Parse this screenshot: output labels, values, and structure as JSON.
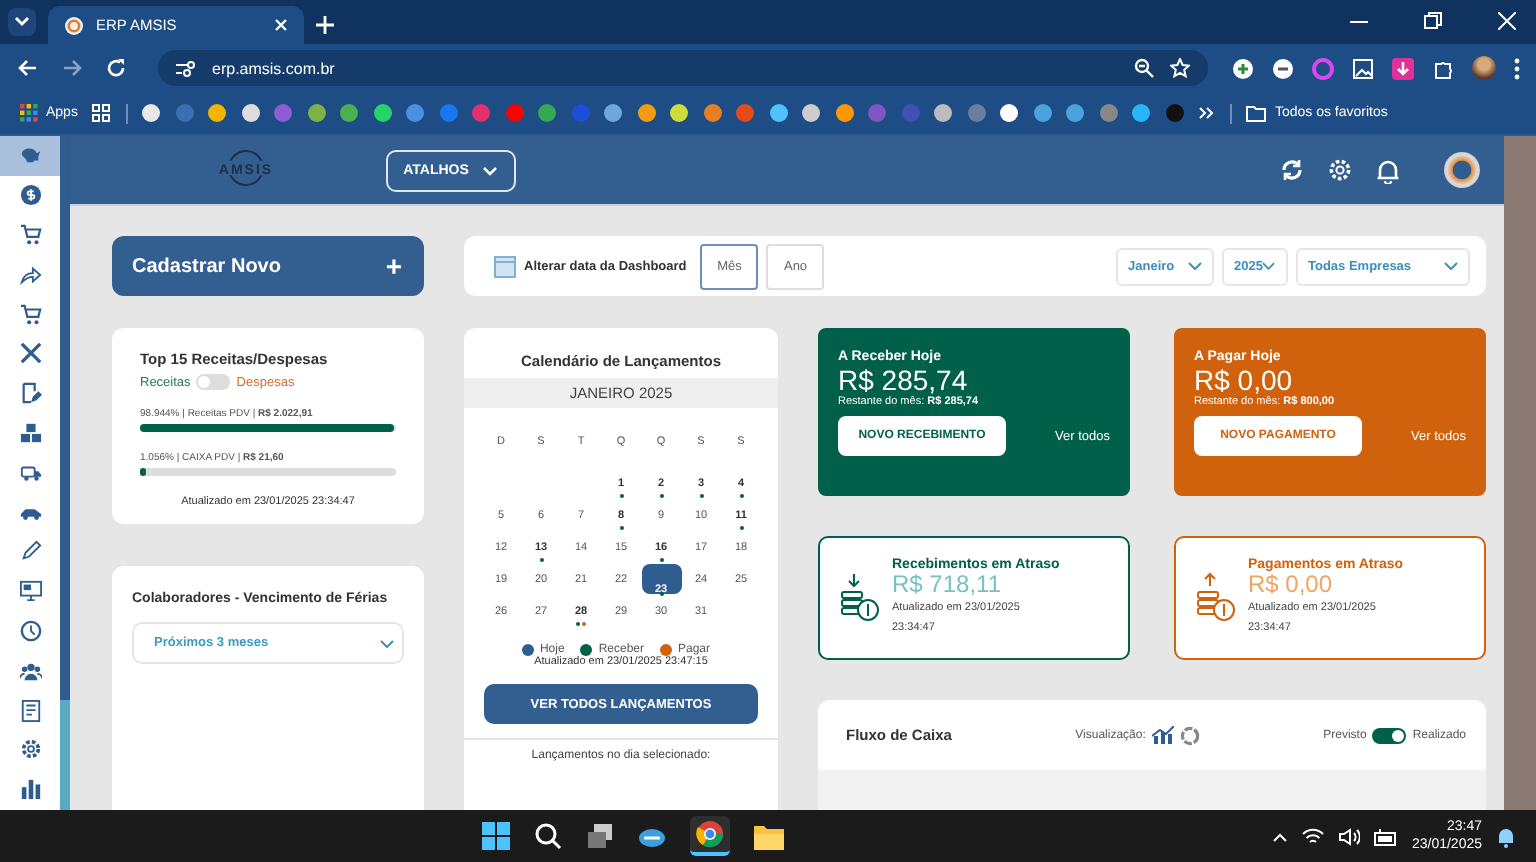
{
  "browser": {
    "tabs": [
      {
        "title": "ERP AMSIS",
        "selected": true
      }
    ],
    "url": "erp.amsis.com.br",
    "apps": "Apps",
    "all_bookmarks": "Todos os favoritos"
  },
  "sidebar": {
    "items": [
      {
        "selected": true
      },
      {
        "selected": false
      },
      {
        "selected": false
      },
      {
        "selected": false
      },
      {
        "selected": false
      },
      {
        "selected": false
      },
      {
        "selected": false
      },
      {
        "selected": false
      },
      {
        "selected": false
      },
      {
        "selected": false
      },
      {
        "selected": false
      },
      {
        "selected": false
      },
      {
        "selected": false
      },
      {
        "selected": false
      },
      {
        "selected": false
      },
      {
        "selected": false
      },
      {
        "selected": false
      }
    ]
  },
  "header": {
    "logo": "AMSIS",
    "shortcuts": "ATALHOS"
  },
  "new_button": {
    "label": "Cadastrar Novo",
    "icon": "+"
  },
  "date_filter": {
    "label": "Alterar data da Dashboard",
    "modes": [
      {
        "label": "Mês",
        "selected": true
      },
      {
        "label": "Ano",
        "selected": false
      }
    ],
    "month": "Janeiro",
    "year": "2025",
    "company": "Todas Empresas"
  },
  "top15": {
    "title": "Top 15 Receitas/Despesas",
    "left_label": "Receitas",
    "right_label": "Despesas",
    "toggle_on": false,
    "items": [
      {
        "text": "98.944% | Receitas PDV | **R$ 2.022,91**",
        "level": 0.989
      },
      {
        "text": "1.056% | CAIXA PDV | **R$ 21,60**",
        "level": 0.011
      }
    ],
    "updated": "Atualizado em 23/01/2025 23:34:47"
  },
  "vacations": {
    "title": "Colaboradores - Vencimento de Férias",
    "period": "Próximos 3 meses"
  },
  "calendar": {
    "title": "Calendário de Lançamentos",
    "month": "JANEIRO 2025",
    "weekdays": [
      "D",
      "S",
      "T",
      "Q",
      "Q",
      "S",
      "S"
    ],
    "days": [
      {
        "label": "1",
        "receive": true,
        "pay": false,
        "today": false
      },
      {
        "label": "2",
        "receive": true,
        "pay": false,
        "today": false
      },
      {
        "label": "3",
        "receive": true,
        "pay": false,
        "today": false
      },
      {
        "label": "4",
        "receive": true,
        "pay": false,
        "today": false
      },
      {
        "label": "5",
        "receive": false,
        "pay": false,
        "today": false
      },
      {
        "label": "6",
        "receive": false,
        "pay": false,
        "today": false
      },
      {
        "label": "7",
        "receive": false,
        "pay": false,
        "today": false
      },
      {
        "label": "8",
        "receive": true,
        "pay": false,
        "today": false
      },
      {
        "label": "9",
        "receive": false,
        "pay": false,
        "today": false
      },
      {
        "label": "10",
        "receive": false,
        "pay": false,
        "today": false
      },
      {
        "label": "11",
        "receive": true,
        "pay": false,
        "today": false
      },
      {
        "label": "12",
        "receive": false,
        "pay": false,
        "today": false
      },
      {
        "label": "13",
        "receive": true,
        "pay": false,
        "today": false
      },
      {
        "label": "14",
        "receive": false,
        "pay": false,
        "today": false
      },
      {
        "label": "15",
        "receive": false,
        "pay": false,
        "today": false
      },
      {
        "label": "16",
        "receive": true,
        "pay": false,
        "today": false
      },
      {
        "label": "17",
        "receive": false,
        "pay": false,
        "today": false
      },
      {
        "label": "18",
        "receive": false,
        "pay": false,
        "today": false
      },
      {
        "label": "19",
        "receive": false,
        "pay": false,
        "today": false
      },
      {
        "label": "20",
        "receive": false,
        "pay": false,
        "today": false
      },
      {
        "label": "21",
        "receive": false,
        "pay": false,
        "today": false
      },
      {
        "label": "22",
        "receive": false,
        "pay": false,
        "today": false
      },
      {
        "label": "23",
        "receive": true,
        "pay": false,
        "today": true
      },
      {
        "label": "24",
        "receive": false,
        "pay": false,
        "today": false
      },
      {
        "label": "25",
        "receive": false,
        "pay": false,
        "today": false
      },
      {
        "label": "26",
        "receive": false,
        "pay": false,
        "today": false
      },
      {
        "label": "27",
        "receive": false,
        "pay": false,
        "today": false
      },
      {
        "label": "28",
        "receive": true,
        "pay": true,
        "today": false
      },
      {
        "label": "29",
        "receive": false,
        "pay": false,
        "today": false
      },
      {
        "label": "30",
        "receive": false,
        "pay": false,
        "today": false
      },
      {
        "label": "31",
        "receive": false,
        "pay": false,
        "today": false
      }
    ],
    "legend": [
      {
        "label": "Hoje",
        "color": "#2f5d8f"
      },
      {
        "label": "Receber",
        "color": "#00604a"
      },
      {
        "label": "Pagar",
        "color": "#d0620e"
      }
    ],
    "updated": "Atualizado em 23/01/2025 23:47:15",
    "button": "VER TODOS LANÇAMENTOS",
    "selected_day_label": "Lançamentos no dia selecionado:"
  },
  "today_cards": [
    {
      "kind": "receive",
      "title": "A Receber Hoje",
      "amount": "R$ 285,74",
      "remaining": "Restante do mês: **R$ 285,74**",
      "button": "NOVO RECEBIMENTO",
      "link": "Ver todos"
    },
    {
      "kind": "pay",
      "title": "A Pagar Hoje",
      "amount": "R$ 0,00",
      "remaining": "Restante do mês: **R$ 800,00**",
      "button": "NOVO PAGAMENTO",
      "link": "Ver todos"
    }
  ],
  "overdue_cards": [
    {
      "kind": "receive",
      "title": "Recebimentos em Atraso",
      "amount": "R$ 718,11",
      "updated": "Atualizado em 23/01/2025 23:34:47"
    },
    {
      "kind": "pay",
      "title": "Pagamentos em Atraso",
      "amount": "R$ 0,00",
      "updated": "Atualizado em 23/01/2025 23:34:47"
    }
  ],
  "cash_flow": {
    "title": "Fluxo de Caixa",
    "view_label": "Visualização:",
    "left_label": "Previsto",
    "right_label": "Realizado",
    "toggle_on": true
  },
  "taskbar": {
    "time": "23:47",
    "date": "23/01/2025"
  }
}
